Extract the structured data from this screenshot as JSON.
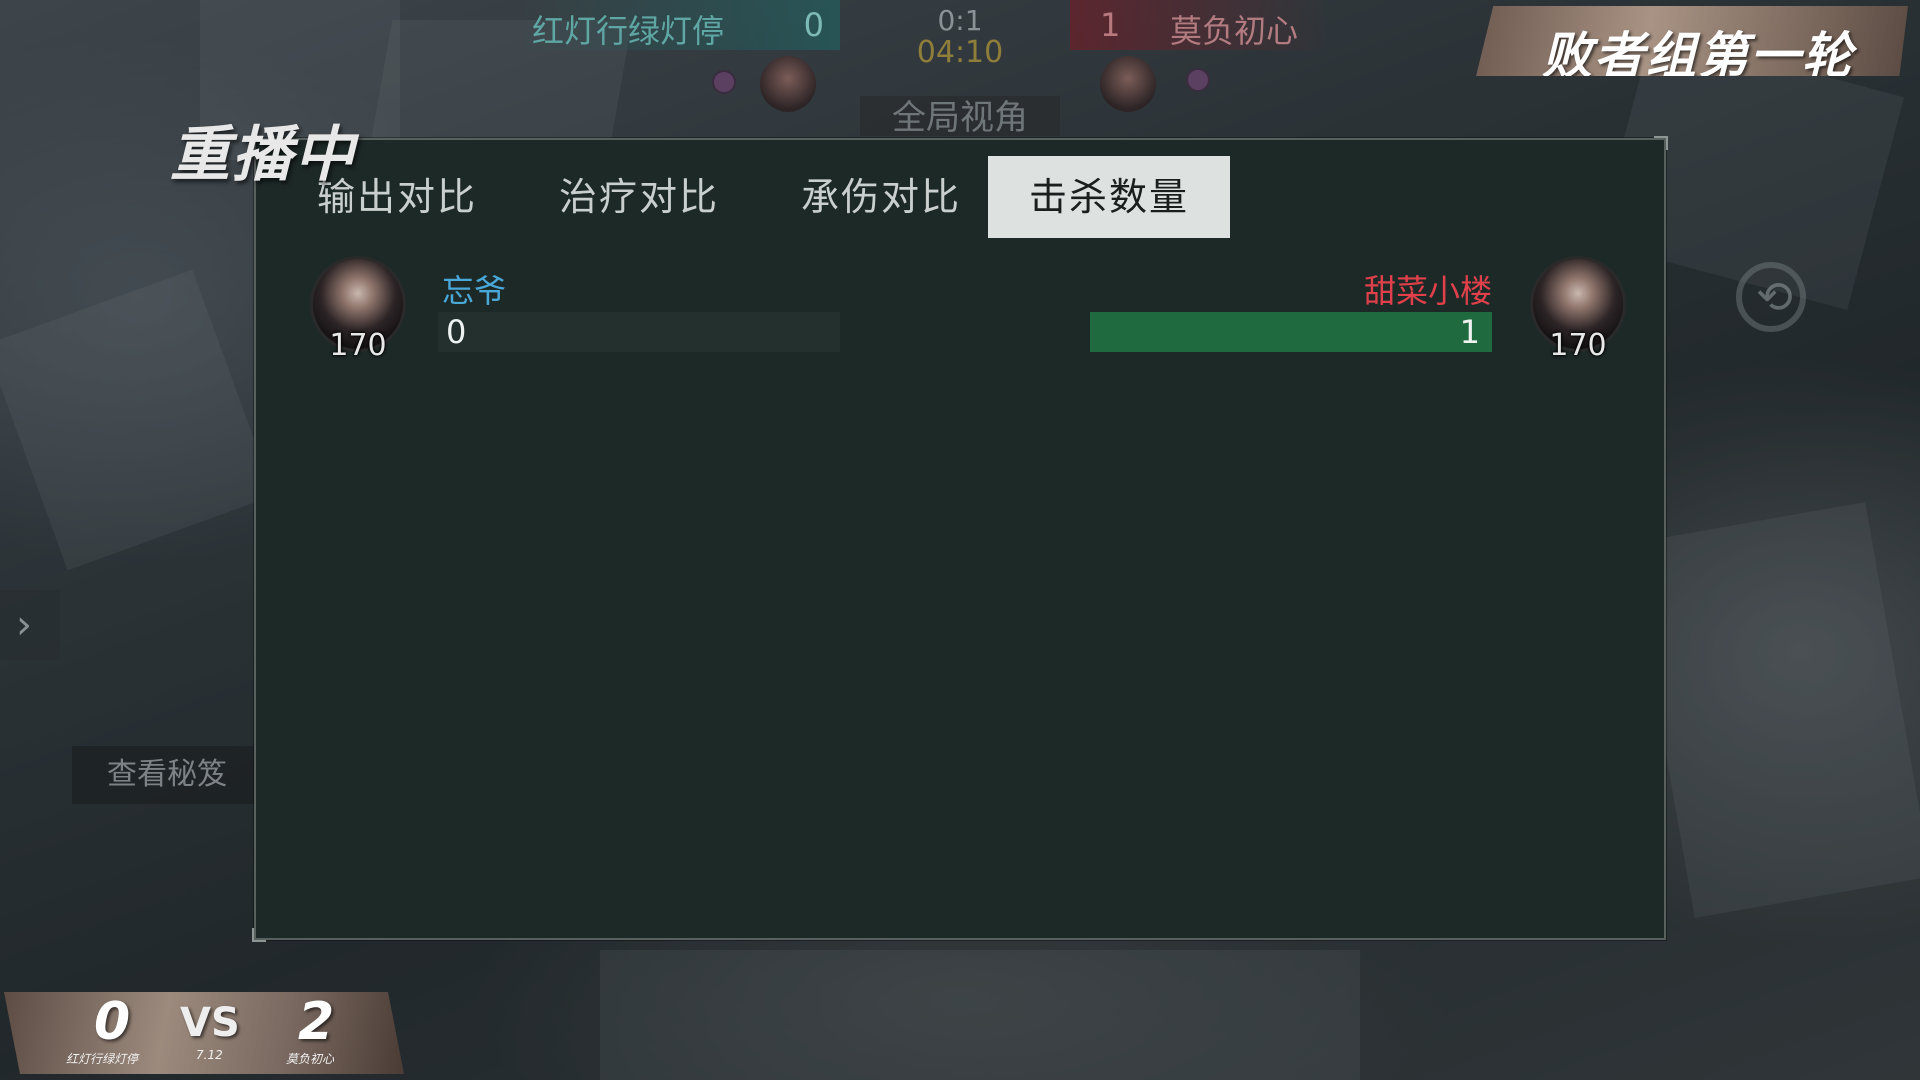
{
  "hud": {
    "team_left_name": "红灯行绿灯停",
    "team_left_score": "0",
    "team_right_score": "1",
    "team_right_name": "莫负初心",
    "round_score": "0:1",
    "timer": "04:10",
    "view_label": "全局视角"
  },
  "round_banner": "败者组第一轮",
  "replay_label": "重播中",
  "side_button": "查看秘笈",
  "tabs": [
    {
      "label": "输出对比",
      "active": false
    },
    {
      "label": "治疗对比",
      "active": false
    },
    {
      "label": "承伤对比",
      "active": false
    },
    {
      "label": "击杀数量",
      "active": true
    }
  ],
  "comparison": {
    "left": {
      "name": "忘爷",
      "level": "170",
      "value": "0",
      "fill_fraction": 0,
      "name_color": "#4aa8d8"
    },
    "right": {
      "name": "甜菜小楼",
      "level": "170",
      "value": "1",
      "fill_fraction": 1,
      "name_color": "#e0404a"
    }
  },
  "bottom_score": {
    "left_score": "0",
    "vs": "VS",
    "right_score": "2",
    "left_team": "红灯行绿灯停",
    "date": "7.12",
    "right_team": "莫负初心"
  }
}
